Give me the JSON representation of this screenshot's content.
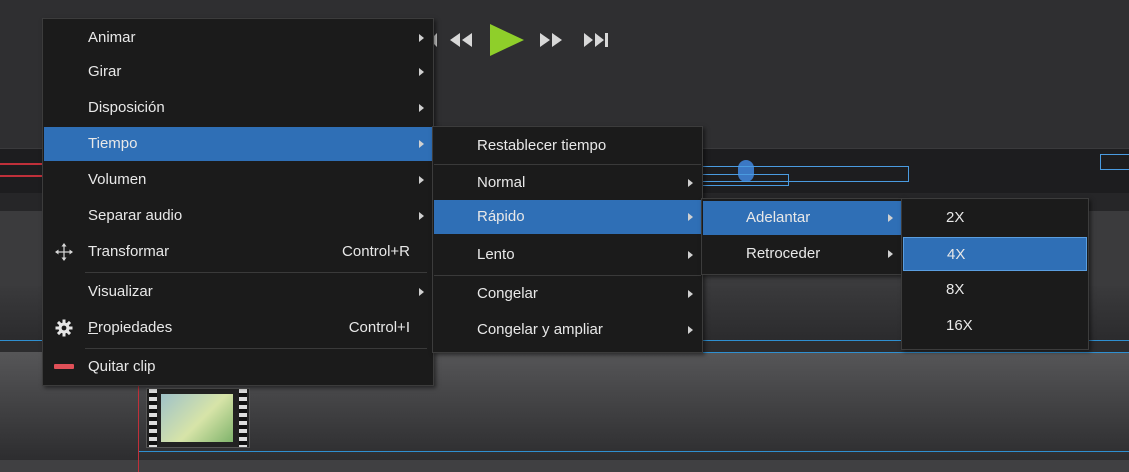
{
  "colors": {
    "highlight": "#2f6fb6",
    "menu_bg": "#1b1b1b",
    "play_green": "#8fcf2a",
    "timeline_blue": "#2f8fd0",
    "playhead_red": "#c0303a"
  },
  "playback": {
    "controls": [
      "prev-frame-icon",
      "rewind-icon",
      "play-icon",
      "fast-forward-icon",
      "skip-end-icon"
    ]
  },
  "context_menu": {
    "items": [
      {
        "label": "Animar",
        "has_submenu": true
      },
      {
        "label": "Girar",
        "has_submenu": true
      },
      {
        "label": "Disposición",
        "has_submenu": true
      },
      {
        "label": "Tiempo",
        "has_submenu": true,
        "highlighted": true
      },
      {
        "label": "Volumen",
        "has_submenu": true
      },
      {
        "label": "Separar audio",
        "has_submenu": true
      },
      {
        "label": "Transformar",
        "shortcut": "Control+R",
        "icon": "move-arrows-icon"
      },
      {
        "label": "Visualizar",
        "has_submenu": true
      },
      {
        "label_prefix": "P",
        "label_rest": "ropiedades",
        "label": "Propiedades",
        "shortcut": "Control+I",
        "icon": "gear-icon"
      },
      {
        "label": "Quitar clip",
        "icon": "remove-bar-icon"
      }
    ]
  },
  "tiempo_menu": {
    "items": [
      {
        "label": "Restablecer tiempo"
      },
      {
        "label": "Normal",
        "has_submenu": true
      },
      {
        "label": "Rápido",
        "has_submenu": true,
        "highlighted": true
      },
      {
        "label": "Lento",
        "has_submenu": true
      },
      {
        "label": "Congelar",
        "has_submenu": true
      },
      {
        "label": "Congelar y ampliar",
        "has_submenu": true
      }
    ]
  },
  "rapido_menu": {
    "items": [
      {
        "label": "Adelantar",
        "has_submenu": true,
        "highlighted": true
      },
      {
        "label": "Retroceder",
        "has_submenu": true
      }
    ]
  },
  "speed_menu": {
    "items": [
      {
        "label": "2X"
      },
      {
        "label": "4X",
        "highlighted": true
      },
      {
        "label": "8X"
      },
      {
        "label": "16X"
      }
    ]
  }
}
